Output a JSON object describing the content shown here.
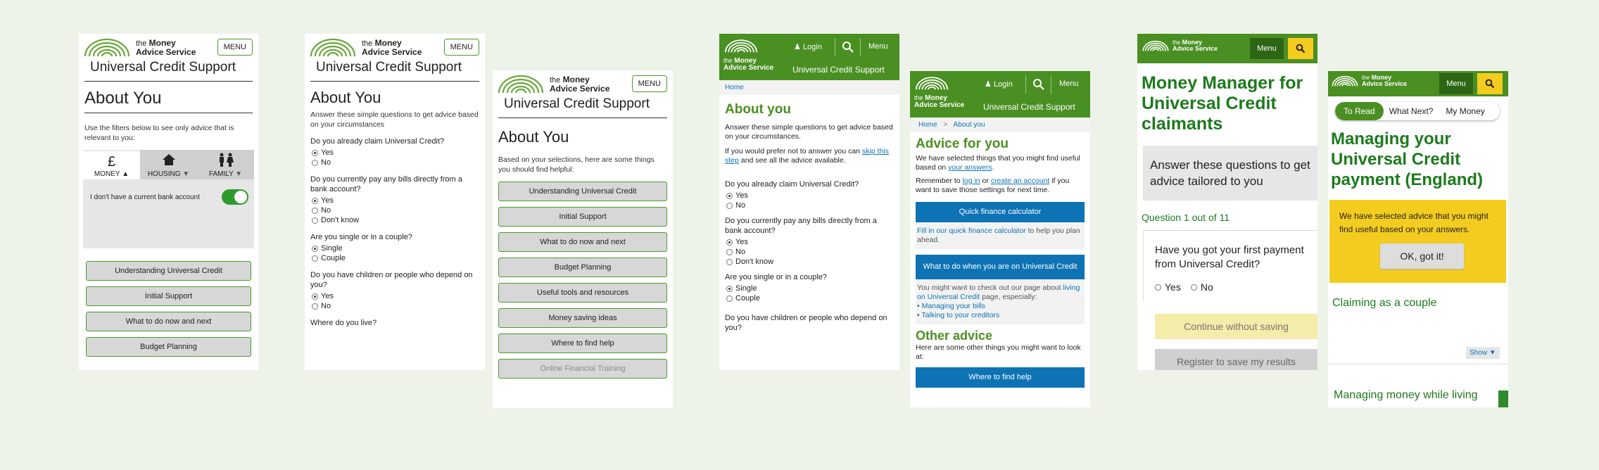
{
  "common": {
    "brand_the": "the",
    "brand_money": "Money",
    "brand_advice": "Advice Service",
    "menu_upper": "MENU",
    "menu": "Menu",
    "login": "Login",
    "universal_credit_support": "Universal Credit Support",
    "about_you": "About You",
    "yes": "Yes",
    "no": "No",
    "dont_know": "Don't know",
    "single": "Single",
    "couple": "Couple"
  },
  "screen1": {
    "intro": "Use the filters below to see only advice that is relevant to you:",
    "tabs": [
      {
        "icon": "£",
        "label": "MONEY"
      },
      {
        "icon": "house",
        "label": "HOUSING"
      },
      {
        "icon": "family",
        "label": "FAMILY"
      }
    ],
    "toggle_label": "I don't have a current bank account",
    "buttons": [
      "Understanding Universal Credit",
      "Initial Support",
      "What to do now and next",
      "Budget Planning"
    ]
  },
  "screen2": {
    "intro": "Answer these simple questions to get advice based on your circumstances",
    "q1": "Do you already claim Universal Credit?",
    "q2": "Do you currently pay any bills directly from a bank account?",
    "q3": "Are you single or in a couple?",
    "q4": "Do you have children or people who depend on you?",
    "q5": "Where do you live?"
  },
  "screen3": {
    "intro": "Based on your selections, here are some things you should find helpful:",
    "buttons": [
      "Understanding Universal Credit",
      "Initial Support",
      "What to do now and next",
      "Budget Planning",
      "Useful tools and resources",
      "Money saving ideas",
      "Where to find help",
      "Online Financial Training"
    ]
  },
  "screen4": {
    "crumb": "Home",
    "title": "About you",
    "intro": "Answer these simple questions to get advice based on your circumstances.",
    "skip_pre": "If you would prefer not to answer you can ",
    "skip_link": "skip this step",
    "skip_post": " and see all the advice available.",
    "q1": "Do you already claim Universal Credit?",
    "q2": "Do you currently pay any bills directly from a bank account?",
    "q3": "Are you single or in a couple?",
    "q4": "Do you have children or people who depend on you?"
  },
  "screen5": {
    "crumb_home": "Home",
    "crumb_sep": ">",
    "crumb_about": "About you",
    "title": "Advice for you",
    "p1_pre": "We have selected things that you might find useful based on ",
    "p1_link": "your answers",
    "p1_post": ".",
    "p2_a": "Remember to ",
    "p2_login": "log in",
    "p2_b": " or ",
    "p2_create": "create an account",
    "p2_c": " if you want to save those settings for next time.",
    "btn1": "Quick finance calculator",
    "p3_link": "Fill in our quick finance calculator",
    "p3_post": " to help you plan ahead.",
    "btn2": "What to do when you are on Universal Credit",
    "p4_pre": "You might want to check out our page about ",
    "p4_link": "living on Universal Credit",
    "p4_post": " page, especially:",
    "bullet1": "Managing your bills",
    "bullet2": "Talking to your creditors",
    "other_title": "Other advice",
    "other_text": "Here are some other things you might want to look at:",
    "btn3": "Where to find help"
  },
  "screen6": {
    "title": "Money Manager for Universal Credit claimants",
    "panel": "Answer these questions to get advice tailored to you",
    "progress": "Question 1 out of 11",
    "question": "Have you got your first payment from Universal Credit?",
    "btn_continue": "Continue without saving",
    "btn_register": "Register to save my results"
  },
  "screen7": {
    "tabs": [
      "To Read",
      "What Next?",
      "My Money"
    ],
    "title": "Managing your Universal Credit payment (England)",
    "notice": "We have selected advice that you might find useful based on your answers.",
    "ok": "OK, got it!",
    "claiming": "Claiming as a couple",
    "show": "Show",
    "managing": "Managing money while living"
  },
  "colors": {
    "green": "#4a8f22",
    "dark_green": "#1d7a1d",
    "blue": "#0e73b4",
    "yellow": "#f4cc1f"
  }
}
